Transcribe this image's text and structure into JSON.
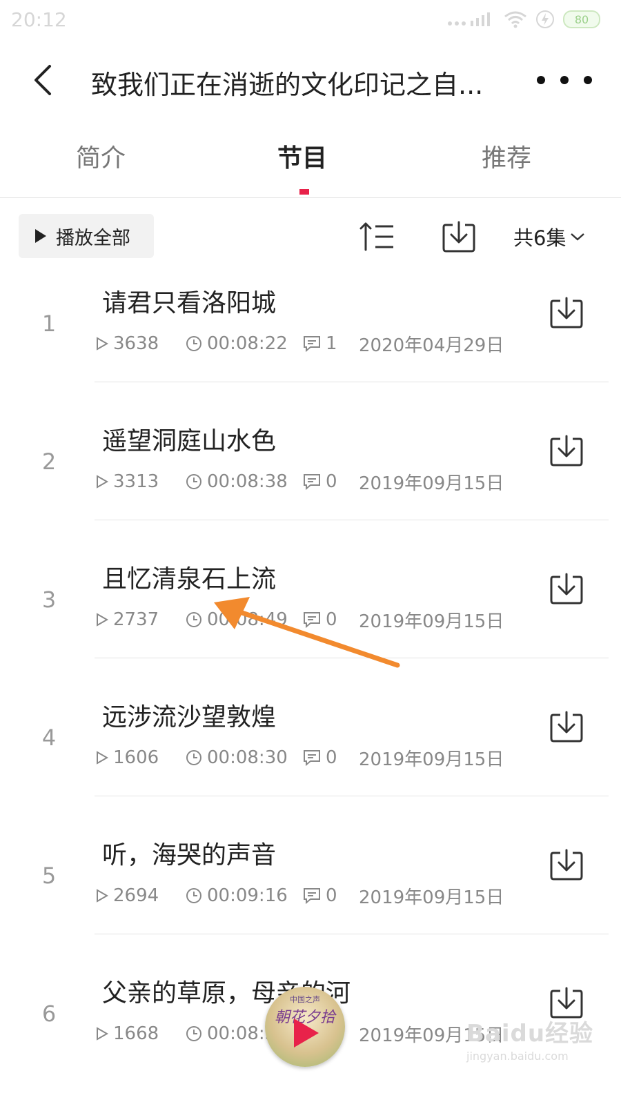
{
  "status_bar": {
    "time": "20:12",
    "battery": "80",
    "battery_color": "#9bd08a"
  },
  "header": {
    "title": "致我们正在消逝的文化印记之自...",
    "back_icon": "chevron-left-icon",
    "more_icon": "more-dots-icon"
  },
  "tabs": [
    {
      "label": "简介",
      "active": false
    },
    {
      "label": "节目",
      "active": true
    },
    {
      "label": "推荐",
      "active": false
    }
  ],
  "toolbar": {
    "play_all_label": "播放全部",
    "episode_count_label": "共6集",
    "sort_icon": "sort-icon",
    "download_icon": "download-icon"
  },
  "accent_color": "#e8224a",
  "episodes": [
    {
      "num": "1",
      "title": "请君只看洛阳城",
      "plays": "3638",
      "duration": "00:08:22",
      "comments": "1",
      "date": "2020年04月29日"
    },
    {
      "num": "2",
      "title": "遥望洞庭山水色",
      "plays": "3313",
      "duration": "00:08:38",
      "comments": "0",
      "date": "2019年09月15日"
    },
    {
      "num": "3",
      "title": "且忆清泉石上流",
      "plays": "2737",
      "duration": "00:08:49",
      "comments": "0",
      "date": "2019年09月15日"
    },
    {
      "num": "4",
      "title": "远涉流沙望敦煌",
      "plays": "1606",
      "duration": "00:08:30",
      "comments": "0",
      "date": "2019年09月15日"
    },
    {
      "num": "5",
      "title": "听，海哭的声音",
      "plays": "2694",
      "duration": "00:09:16",
      "comments": "0",
      "date": "2019年09月15日"
    },
    {
      "num": "6",
      "title": "父亲的草原，母亲的河",
      "plays": "1668",
      "duration": "00:08:5",
      "comments": "",
      "date": "2019年09月15日"
    }
  ],
  "mini_player": {
    "line1": "中国之声",
    "line2": "朝花夕拾"
  },
  "watermark": {
    "main": "Baidu经验",
    "sub": "jingyan.baidu.com"
  }
}
